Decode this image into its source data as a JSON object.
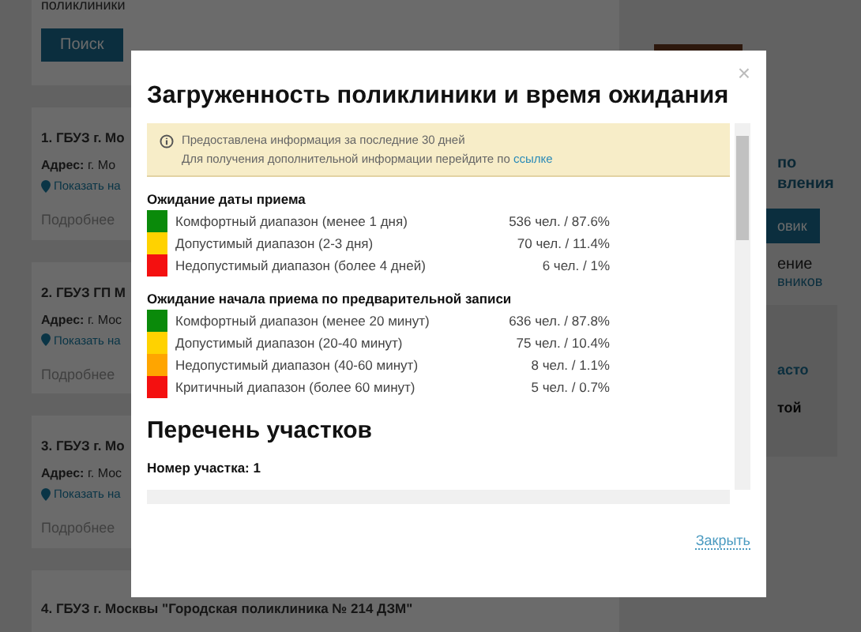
{
  "background": {
    "search_card": {
      "label": "поликлиники",
      "button": "Поиск"
    },
    "results": [
      {
        "title": "1. ГБУЗ г. Мо",
        "address_label": "Адрес:",
        "address": "г. Мо",
        "map_link": "Показать на",
        "more": "Подробнее"
      },
      {
        "title": "2. ГБУЗ ГП М",
        "address_label": "Адрес:",
        "address": "г. Мос",
        "map_link": "Показать на",
        "more": "Подробнее"
      },
      {
        "title": "3. ГБУЗ г. Мо",
        "address_label": "Адрес:",
        "address": "г. Мос",
        "map_link": "Показать на",
        "more": "Подробнее"
      }
    ],
    "last_result": "4. ГБУЗ г. Москвы \"Городская поликлиника № 214 ДЗМ\"",
    "sidebar": {
      "link_lines": [
        "по",
        "вления"
      ],
      "button": "овик",
      "text": "ение",
      "link": "вников",
      "card_link": "асто",
      "card_text": "той"
    }
  },
  "modal": {
    "title": "Загруженность поликлиники и время ожидания",
    "close": "×",
    "notice": {
      "line_1": "Предоставлена информация за последние 30 дней",
      "line_2": "Для получения дополнительной информации перейдите по",
      "link": "ссылке"
    },
    "sections": [
      {
        "title": "Ожидание даты приема",
        "rows": [
          {
            "color": "#0a8a0a",
            "label": "Комфортный диапазон (менее 1 дня)",
            "value": "536 чел. / 87.6%"
          },
          {
            "color": "#ffd200",
            "label": "Допустимый диапазон (2-3 дня)",
            "value": "70 чел. / 11.4%"
          },
          {
            "color": "#f41010",
            "label": "Недопустимый диапазон (более 4 дней)",
            "value": "6 чел. / 1%"
          }
        ]
      },
      {
        "title": "Ожидание начала приема по предварительной записи",
        "rows": [
          {
            "color": "#0a8a0a",
            "label": "Комфортный диапазон (менее 20 минут)",
            "value": "636 чел. / 87.8%"
          },
          {
            "color": "#ffd200",
            "label": "Допустимый диапазон (20-40 минут)",
            "value": "75 чел. / 10.4%"
          },
          {
            "color": "#ffa500",
            "label": "Недопустимый диапазон (40-60 минут)",
            "value": "8 чел. / 1.1%"
          },
          {
            "color": "#f41010",
            "label": "Критичный диапазон (более 60 минут)",
            "value": "5 чел. / 0.7%"
          }
        ]
      }
    ],
    "list_heading": "Перечень участков",
    "list_item": "Номер участка: 1",
    "footer_link": "Закрыть"
  }
}
